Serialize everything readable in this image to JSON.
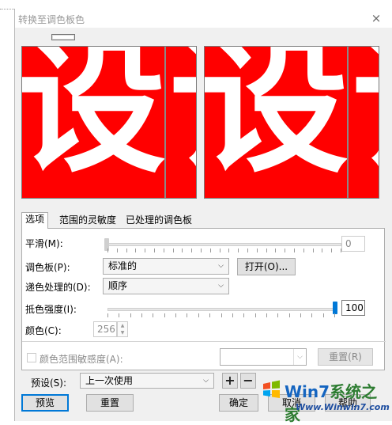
{
  "window": {
    "title": "转换至调色板色",
    "close_glyph": "×"
  },
  "preview": {
    "left_glyph": "设",
    "right_glyph": "设",
    "glyph_partial": "记"
  },
  "tabs": [
    {
      "label": "选项",
      "active": true
    },
    {
      "label": "范围的灵敏度",
      "active": false
    },
    {
      "label": "已处理的调色板",
      "active": false
    }
  ],
  "options": {
    "smoothing": {
      "label": "平滑(M):",
      "value": "0",
      "level": 0
    },
    "palette": {
      "label": "调色板(P):",
      "selected": "标准的",
      "open_button": "打开(O)..."
    },
    "dithering": {
      "label": "递色处理的(D):",
      "selected": "顺序"
    },
    "dither_strength": {
      "label": "抵色强度(I):",
      "value": "100",
      "level": 1.0
    },
    "colors": {
      "label": "颜色(C):",
      "value": "256"
    },
    "color_range": {
      "label": "颜色范围敏感度(A):",
      "checked": false,
      "reset_button": "重置(R)"
    }
  },
  "preset": {
    "label": "预设(S):",
    "selected": "上一次使用",
    "add_glyph": "+",
    "remove_glyph": "−"
  },
  "buttons": {
    "preview": "预览",
    "reset": "重置",
    "ok": "确定",
    "cancel": "取消",
    "help": "帮助"
  },
  "watermark": {
    "brand_a": "Win7",
    "brand_b": "系统之家",
    "url": "Www.Winwin7.com"
  },
  "colors_theme": {
    "accent": "#0078d7",
    "preview_bg": "#ff0000"
  }
}
